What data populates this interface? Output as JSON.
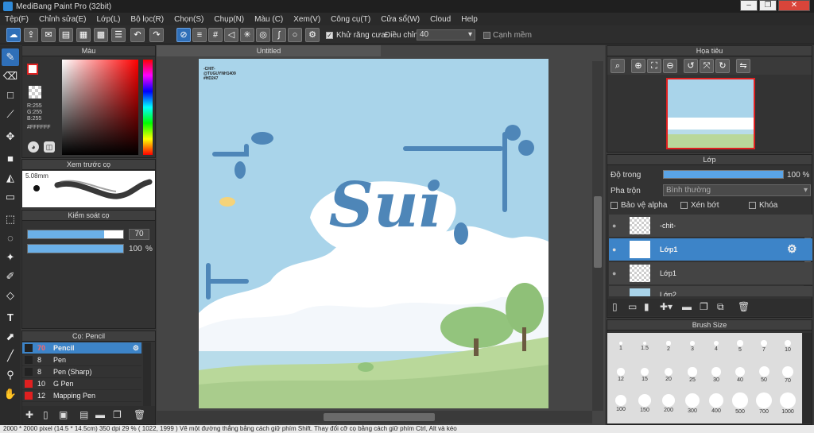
{
  "app": {
    "title": "MediBang Paint Pro (32bit)"
  },
  "menu": [
    "Tệp(F)",
    "Chỉnh sửa(E)",
    "Lớp(L)",
    "Bộ lọc(R)",
    "Chọn(S)",
    "Chụp(N)",
    "Màu (C)",
    "Xem(V)",
    "Công cụ(T)",
    "Cửa sổ(W)",
    "Cloud",
    "Help"
  ],
  "toolbar": {
    "antialias_label": "Khử răng cưa",
    "adjust_label": "Điều chỉnh",
    "adjust_value": "40",
    "snap_label": "Cạnh mềm"
  },
  "color_panel": {
    "title": "Màu",
    "r": "R:255",
    "g": "G:255",
    "b": "B:255",
    "hex": "#FFFFFF"
  },
  "brush_preview": {
    "title": "Xem trước cọ",
    "size": "5.08mm"
  },
  "brush_control": {
    "title": "Kiểm soát cọ",
    "size_value": "70",
    "opacity_value": "100",
    "opacity_unit": "%",
    "size_fraction": 0.8,
    "opacity_fraction": 1.0
  },
  "brush_list": {
    "title": "Cọ: Pencil",
    "items": [
      {
        "size": "70",
        "name": "Pencil",
        "color": "#222222",
        "active": true
      },
      {
        "size": "8",
        "name": "Pen",
        "color": "#222222"
      },
      {
        "size": "8",
        "name": "Pen (Sharp)",
        "color": "#222222"
      },
      {
        "size": "10",
        "name": "G Pen",
        "color": "#e02020"
      },
      {
        "size": "12",
        "name": "Mapping Pen",
        "color": "#e02020"
      }
    ]
  },
  "document": {
    "tab": "Untitled",
    "watermark": [
      "-CHIT-",
      "@TUGUYNH1409",
      "#HD247"
    ],
    "artwork_text": "Sui"
  },
  "navigator": {
    "title": "Họa tiêu"
  },
  "layers": {
    "title": "Lớp",
    "opacity_label": "Độ trong",
    "opacity_value": "100 %",
    "opacity_fraction": 1.0,
    "blend_label": "Pha trộn",
    "blend_value": "Bình thường",
    "protect_alpha": "Bảo vệ alpha",
    "clip": "Xén bớt",
    "lock": "Khóa",
    "rows": [
      {
        "name": "-chit-",
        "selected": false
      },
      {
        "name": "Lớp1",
        "selected": true
      },
      {
        "name": "Lớp1",
        "selected": false
      },
      {
        "name": "Lớp2",
        "selected": false
      }
    ]
  },
  "brush_size": {
    "title": "Brush Size",
    "sizes": [
      "1",
      "1.5",
      "2",
      "3",
      "4",
      "5",
      "7",
      "10",
      "12",
      "15",
      "20",
      "25",
      "30",
      "40",
      "50",
      "70",
      "100",
      "150",
      "200",
      "300",
      "400",
      "500",
      "700",
      "1000"
    ]
  },
  "status": "2000 * 2000 pixel   (14.5 * 14.5cm)   350 dpi   29 %   ( 1022, 1999 )   Vẽ một đường thẳng bằng cách giữ phím Shift. Thay đổi cỡ cọ bằng cách giữ phím Ctrl, Alt và kéo"
}
